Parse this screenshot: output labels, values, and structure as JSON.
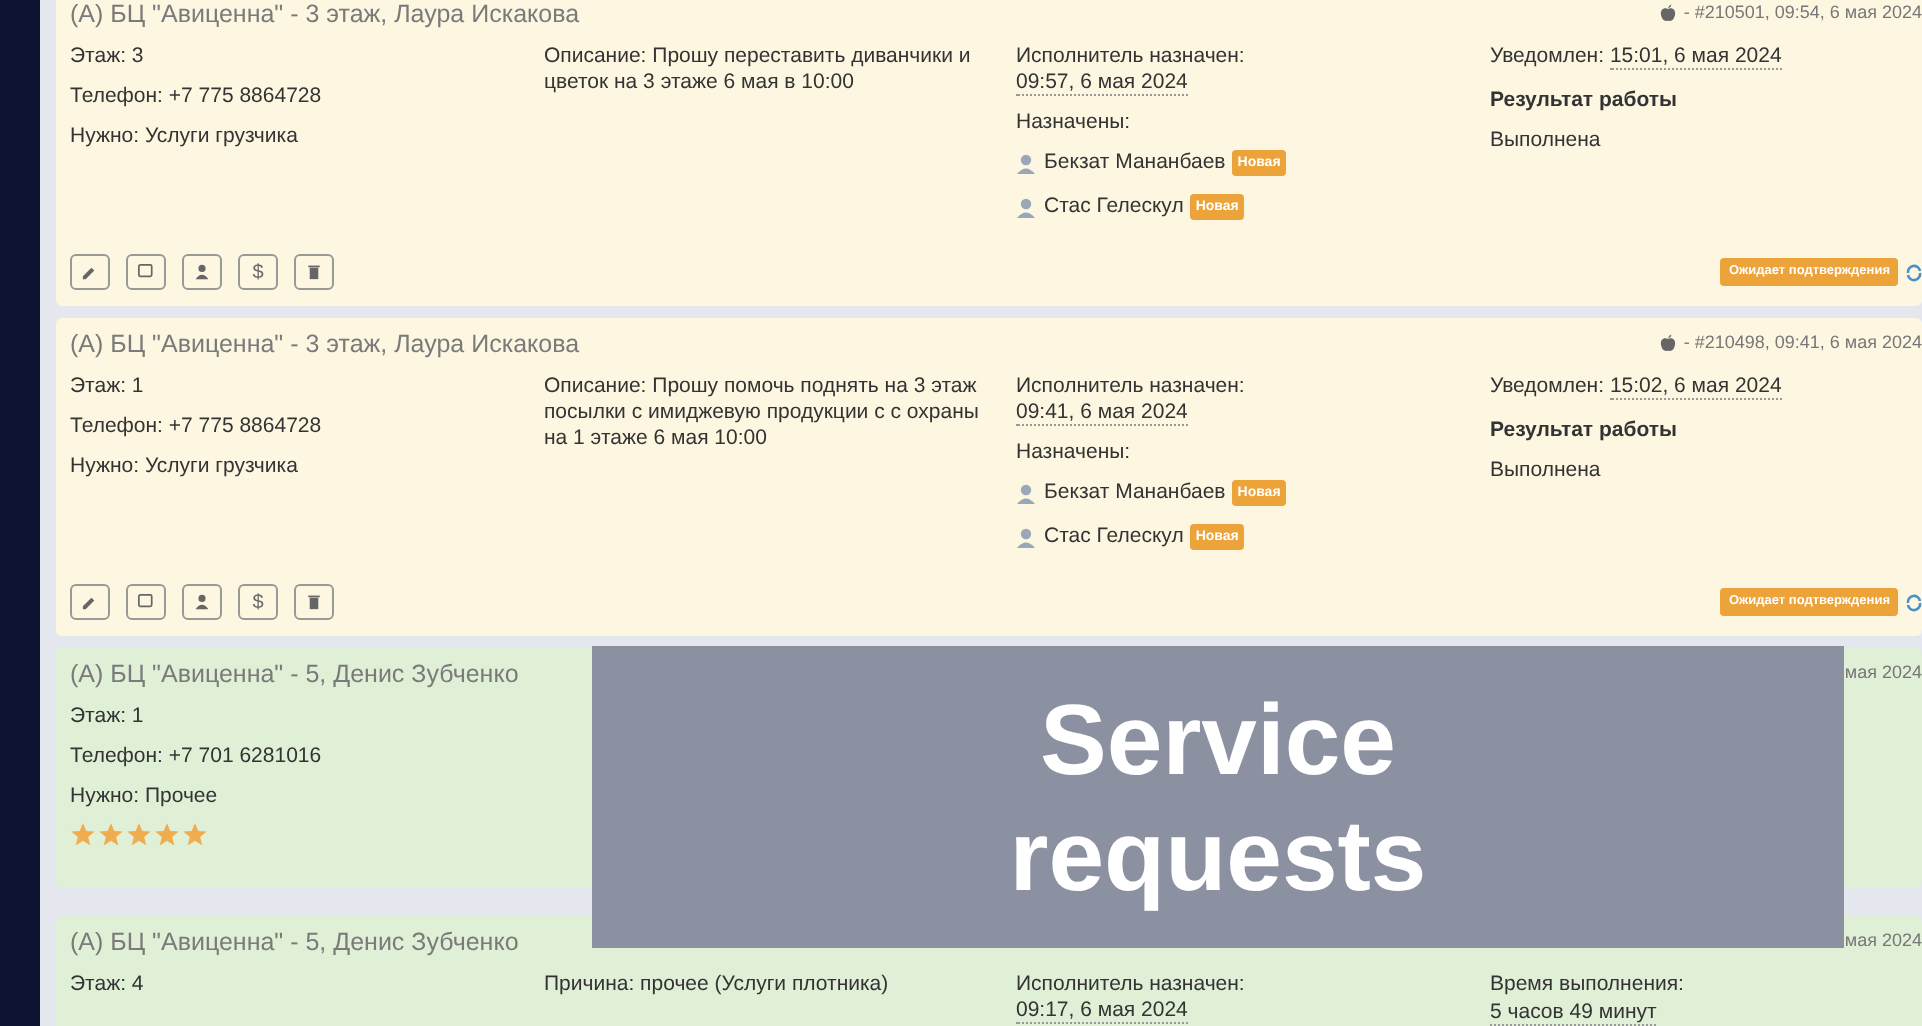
{
  "cards": [
    {
      "completed": false,
      "title": "(А) БЦ \"Авиценна\" - 3 этаж, Лаура Искакова",
      "ref_icon": true,
      "ref": "- #210501, 09:54, 6 мая 2024",
      "info": [
        "Этаж: 3",
        "Телефон: +7 775 8864728",
        "Нужно: Услуги грузчика"
      ],
      "details": [
        "Описание: Прошу переставить диванчики и цветок на 3 этаже 6 мая в 10:00"
      ],
      "assigned": {
        "label": "Исполнитель назначен:",
        "time": "09:57, 6 мая 2024"
      },
      "assignees_label": "Назначены:",
      "assignees": [
        {
          "name": "Бекзат Мананбаев",
          "badge": "Новая"
        },
        {
          "name": "Стас Гелескул",
          "badge": "Новая"
        }
      ],
      "result": [
        {
          "kind": "notified",
          "label": "Уведомлен:",
          "time": "15:01, 6 мая 2024"
        },
        {
          "kind": "heading",
          "text": "Результат работы"
        },
        {
          "kind": "plain",
          "text": "Выполнена"
        }
      ],
      "actions": [
        {
          "kind": "edit"
        },
        {
          "kind": "comment"
        },
        {
          "kind": "user"
        },
        {
          "kind": "glyph",
          "label": "$"
        },
        {
          "kind": "delete"
        }
      ],
      "state_badge": "Ожидает подтверждения"
    },
    {
      "completed": false,
      "title": "(А) БЦ \"Авиценна\" - 3 этаж, Лаура Искакова",
      "ref_icon": true,
      "ref": "- #210498, 09:41, 6 мая 2024",
      "info": [
        "Этаж: 1",
        "Телефон: +7 775 8864728",
        "Нужно: Услуги грузчика"
      ],
      "details": [
        "Описание: Прошу помочь поднять на 3 этаж посылки с имиджевую продукции с с охраны на 1 этаже 6 мая 10:00"
      ],
      "assigned": {
        "label": "Исполнитель назначен:",
        "time": "09:41, 6 мая 2024"
      },
      "assignees_label": "Назначены:",
      "assignees": [
        {
          "name": "Бекзат Мананбаев",
          "badge": "Новая"
        },
        {
          "name": "Стас Гелескул",
          "badge": "Новая"
        }
      ],
      "result": [
        {
          "kind": "notified",
          "label": "Уведомлен:",
          "time": "15:02, 6 мая 2024"
        },
        {
          "kind": "heading",
          "text": "Результат работы"
        },
        {
          "kind": "plain",
          "text": "Выполнена"
        }
      ],
      "actions": [
        {
          "kind": "edit"
        },
        {
          "kind": "comment"
        },
        {
          "kind": "user"
        },
        {
          "kind": "glyph",
          "label": "$"
        },
        {
          "kind": "delete"
        }
      ],
      "state_badge": "Ожидает подтверждения"
    },
    {
      "completed": true,
      "title": "(А) БЦ \"Авиценна\" - 5, Денис Зубченко",
      "ref": "мая 2024",
      "info": [
        "Этаж: 1",
        "Телефон: +7 701 6281016",
        "Нужно: Прочее"
      ],
      "stars": 5
    },
    {
      "completed": true,
      "title": "(А) БЦ \"Авиценна\" - 5, Денис Зубченко",
      "ref": "мая 2024",
      "info": [
        "Этаж: 4"
      ],
      "details": [
        "Причина: прочее (Услуги плотника)"
      ],
      "assigned": {
        "label": "Исполнитель назначен:",
        "time": "09:17, 6 мая 2024"
      },
      "result": [
        {
          "kind": "plain",
          "text": "Время выполнения:"
        },
        {
          "kind": "dotted",
          "text": "5 часов 49 минут"
        }
      ]
    }
  ],
  "banner": {
    "text": "Service requests"
  }
}
